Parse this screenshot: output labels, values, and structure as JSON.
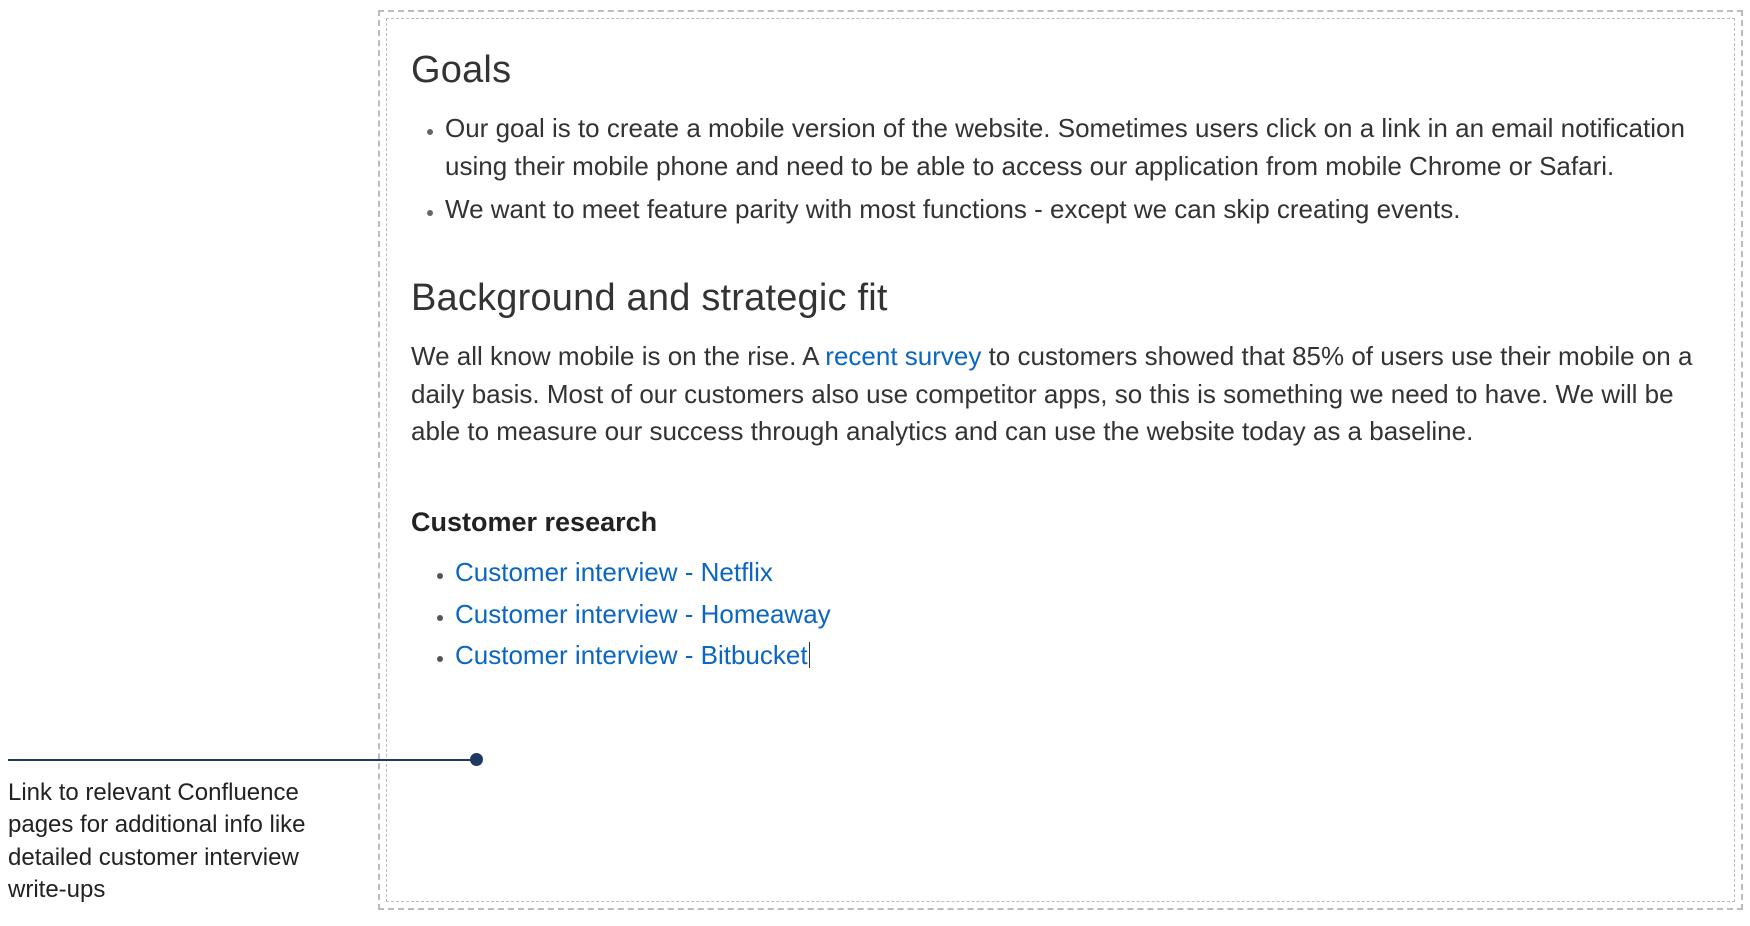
{
  "sections": {
    "goals": {
      "heading": "Goals",
      "items": [
        "Our goal is to create a mobile version of the website. Sometimes users click on a link in an email notification using their mobile phone and need to be able to access our application from mobile Chrome or Safari.",
        "We want to meet feature parity with most functions - except we can skip creating events."
      ]
    },
    "background": {
      "heading": "Background and strategic fit",
      "text_before_link": "We all know mobile is on the rise. A ",
      "link_text": "recent survey",
      "text_after_link": " to customers showed that 85% of users use their mobile on a daily basis. Most of our customers also use competitor apps, so this is something we need to have. We will be able to measure our success through analytics and can use the website today as a baseline."
    },
    "research": {
      "heading": "Customer research",
      "links": [
        "Customer interview - Netflix",
        "Customer interview - Homeaway",
        "Customer interview - Bitbucket"
      ]
    }
  },
  "annotation": {
    "text": "Link to relevant Confluence pages for additional info like detailed customer interview write-ups"
  },
  "colors": {
    "link": "#0b66c3",
    "pointer": "#1f3a5f"
  }
}
